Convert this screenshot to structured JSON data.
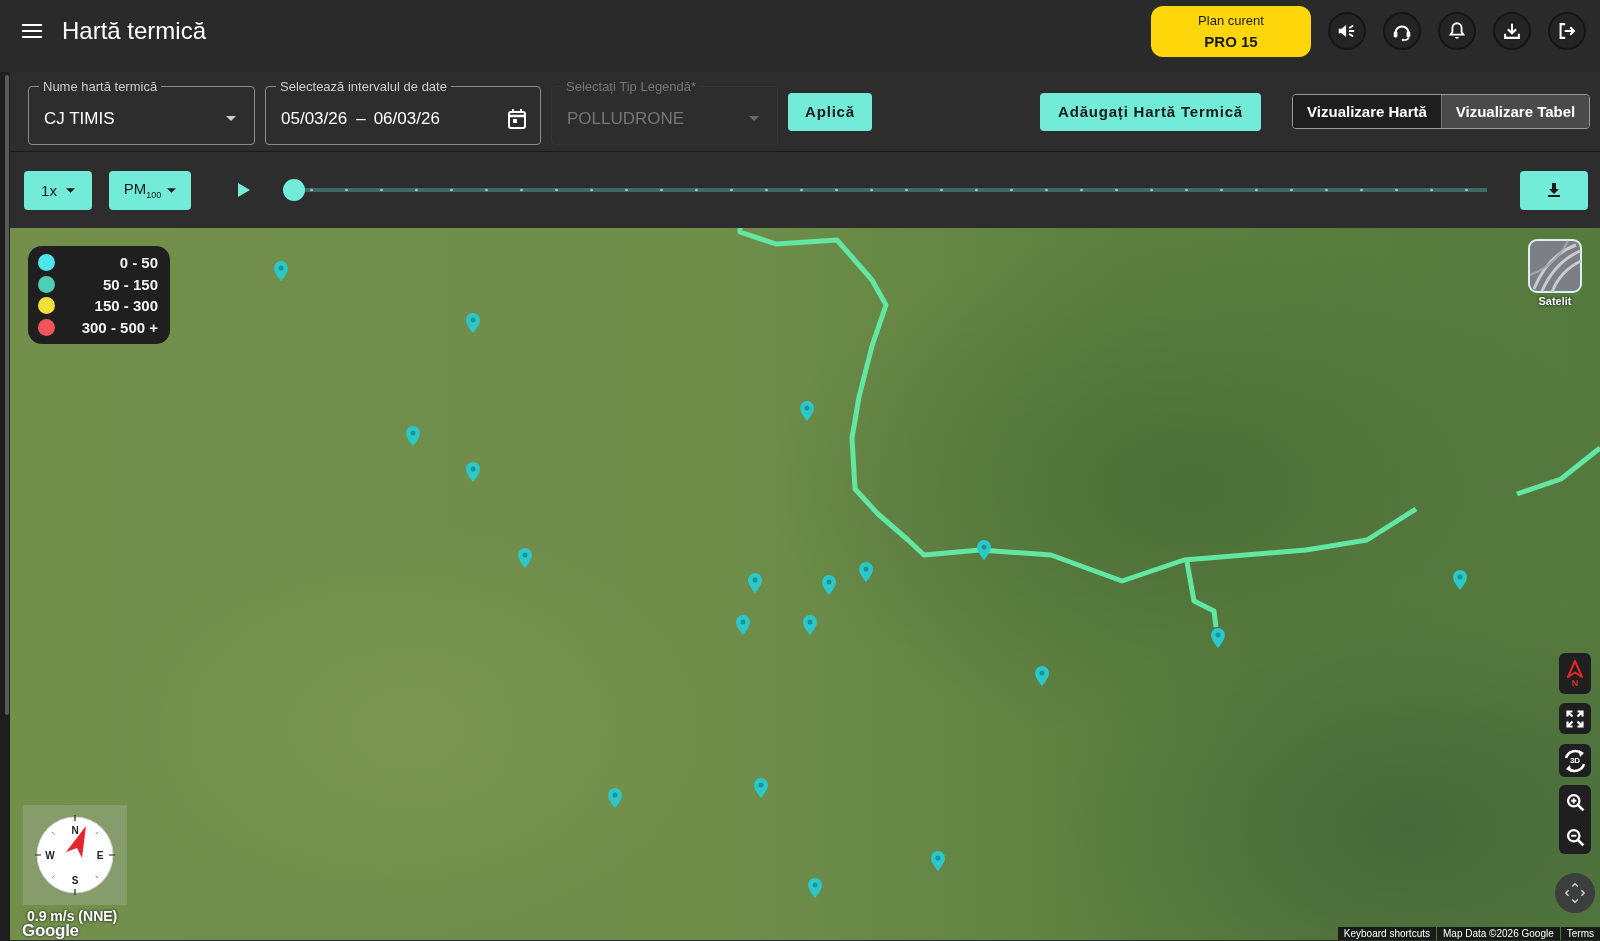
{
  "header": {
    "title": "Hartă termică",
    "plan": {
      "label": "Plan curent",
      "name": "PRO 15"
    }
  },
  "filters": [
    {
      "kind": "select",
      "label": "Nume hartă termică",
      "value": "CJ TIMIS",
      "disabled": false
    },
    {
      "kind": "date_range",
      "label": "Selectează intervalul de date",
      "start": "05/03/26",
      "separator": "–",
      "end": "06/03/26"
    },
    {
      "kind": "select",
      "label": "Selectați Tip Legendă*",
      "value": "POLLUDRONE",
      "disabled": true
    }
  ],
  "apply_button": "Aplică",
  "add_button": "Adăugați Hartă Termică",
  "view_toggle": [
    {
      "label": "Vizualizare Hartă",
      "selected": true
    },
    {
      "label": "Vizualizare Tabel",
      "selected": false
    }
  ],
  "playback": {
    "speed": "1x",
    "pollutant": "PM$_{100}$",
    "level": 0
  },
  "map": {
    "legend": [
      {
        "range": "0 - 50",
        "color": "#4ee6ec"
      },
      {
        "range": "50 - 150",
        "color": "#4ecfb4"
      },
      {
        "range": "150 - 300",
        "color": "#f1df3c"
      },
      {
        "range": "300 - 500 +",
        "color": "#f2545b"
      }
    ],
    "layer_button": "Satelit",
    "north_label": "N",
    "tilt_label": "3D",
    "wind": {
      "dial_labels": [
        "N",
        "E",
        "S",
        "W"
      ],
      "reading": "0.9 m/s (NNE)"
    },
    "logo": "Google",
    "attribution": [
      "Keyboard shortcuts",
      "Map Data ©2026 Google",
      "Terms"
    ]
  }
}
